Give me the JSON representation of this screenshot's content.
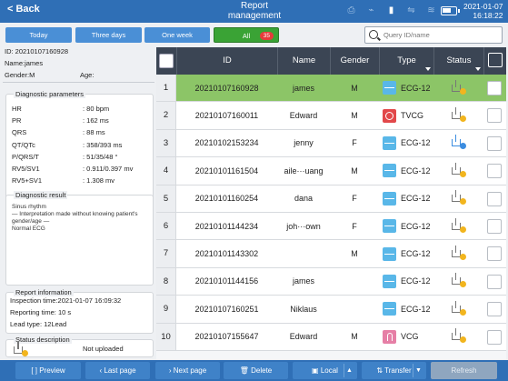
{
  "header": {
    "back_label": "Back",
    "title_line1": "Report",
    "title_line2": "management",
    "date": "2021-01-07",
    "time": "16:18:22"
  },
  "filters": {
    "today": "Today",
    "three_days": "Three days",
    "one_week": "One week",
    "all": "All",
    "all_count": "35"
  },
  "search": {
    "placeholder": "Query ID/name"
  },
  "patient": {
    "id": "ID: 20210107160928",
    "name": "Name:james",
    "gender": "Gender:M",
    "age": "Age:"
  },
  "diagnostic_params": {
    "legend": "Diagnostic parameters",
    "items": [
      {
        "label": "HR",
        "value": ": 80 bpm"
      },
      {
        "label": "PR",
        "value": ": 162 ms"
      },
      {
        "label": "QRS",
        "value": ": 88 ms"
      },
      {
        "label": "QT/QTc",
        "value": ": 358/393 ms"
      },
      {
        "label": "P/QRS/T",
        "value": ": 51/35/48 °"
      },
      {
        "label": "RV5/SV1",
        "value": ": 0.911/0.397 mv"
      },
      {
        "label": "RV5+SV1",
        "value": ": 1.308 mv"
      }
    ]
  },
  "diagnostic_result": {
    "legend": "Diagnostic result",
    "line1": "Sinus rhythm",
    "line2": "— Interpretation made without knowing patient's",
    "line3": "gender/age —",
    "line4": "Normal ECG"
  },
  "report_info": {
    "legend": "Report information",
    "inspection_time": "Inspection time:2021-01-07 16:09:32",
    "reporting_time": "Reporting time: 10 s",
    "lead_type": "Lead type: 12Lead"
  },
  "status_desc": {
    "legend": "Status description",
    "text": "Not uploaded"
  },
  "table": {
    "headers": {
      "id": "ID",
      "name": "Name",
      "gender": "Gender",
      "type": "Type",
      "status": "Status"
    },
    "rows": [
      {
        "num": "1",
        "id": "20210107160928",
        "name": "james",
        "gender": "M",
        "type": "ECG-12",
        "kind": "ecg",
        "status": "pending"
      },
      {
        "num": "2",
        "id": "20210107160011",
        "name": "Edward",
        "gender": "M",
        "type": "TVCG",
        "kind": "tvcg",
        "status": "pending"
      },
      {
        "num": "3",
        "id": "20210102153234",
        "name": "jenny",
        "gender": "F",
        "type": "ECG-12",
        "kind": "ecg",
        "status": "done"
      },
      {
        "num": "4",
        "id": "20210101161504",
        "name": "aile···uang",
        "gender": "M",
        "type": "ECG-12",
        "kind": "ecg",
        "status": "pending"
      },
      {
        "num": "5",
        "id": "20210101160254",
        "name": "dana",
        "gender": "F",
        "type": "ECG-12",
        "kind": "ecg",
        "status": "pending"
      },
      {
        "num": "6",
        "id": "20210101144234",
        "name": "joh···own",
        "gender": "F",
        "type": "ECG-12",
        "kind": "ecg",
        "status": "pending"
      },
      {
        "num": "7",
        "id": "20210101143302",
        "name": "",
        "gender": "M",
        "type": "ECG-12",
        "kind": "ecg",
        "status": "pending"
      },
      {
        "num": "8",
        "id": "20210101144156",
        "name": "james",
        "gender": "",
        "type": "ECG-12",
        "kind": "ecg",
        "status": "pending"
      },
      {
        "num": "9",
        "id": "20210107160251",
        "name": "Niklaus",
        "gender": "",
        "type": "ECG-12",
        "kind": "ecg",
        "status": "pending"
      },
      {
        "num": "10",
        "id": "20210107155647",
        "name": "Edward",
        "gender": "M",
        "type": "VCG",
        "kind": "vcg",
        "status": "pending"
      }
    ]
  },
  "footer": {
    "preview": "Preview",
    "last_page": "Last page",
    "next_page": "Next page",
    "delete": "Delete",
    "local": "Local",
    "transfer": "Transfer",
    "refresh": "Refresh"
  },
  "colors": {
    "accent": "#2f6fb6",
    "selected_row": "#8cc567",
    "header_dark": "#3b4554"
  }
}
